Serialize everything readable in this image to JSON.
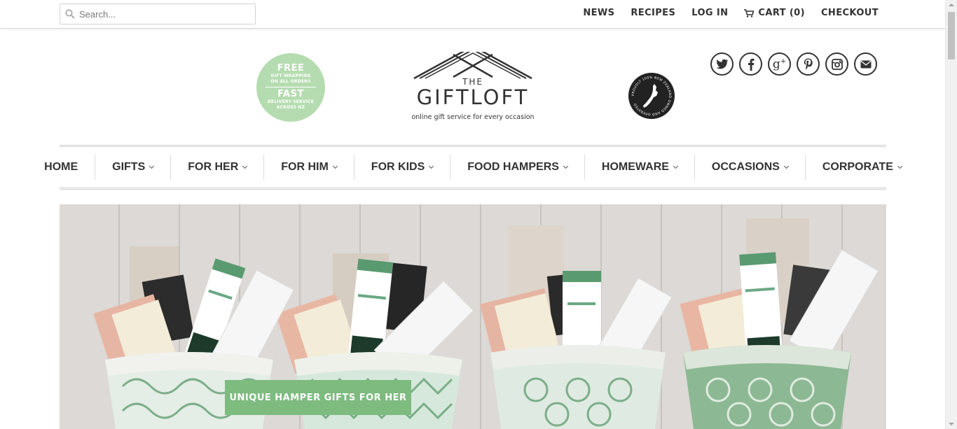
{
  "search": {
    "placeholder": "Search...",
    "icon": "search-icon"
  },
  "toplinks": [
    {
      "label": "NEWS"
    },
    {
      "label": "RECIPES"
    },
    {
      "label": "LOG IN"
    },
    {
      "label": "CART (0)",
      "icon": "cart-icon"
    },
    {
      "label": "CHECKOUT"
    }
  ],
  "badge": {
    "free": "FREE",
    "free_sub_1": "GIFT WRAPPING",
    "free_sub_2": "ON ALL ORDERS",
    "fast": "FAST",
    "fast_sub_1": "DELIVERY SERVICE",
    "fast_sub_2": "ACROSS NZ",
    "color": "#b5dcb0"
  },
  "logo": {
    "the": "THE",
    "name": "GIFTLOFT",
    "tagline": "online gift service for every occasion"
  },
  "nz_badge": {
    "text": "PROUDLY 100% NEW ZEALAND OWNED AND OPERATED"
  },
  "social": [
    {
      "icon": "twitter-icon"
    },
    {
      "icon": "facebook-icon"
    },
    {
      "icon": "google-plus-icon"
    },
    {
      "icon": "pinterest-icon"
    },
    {
      "icon": "instagram-icon"
    },
    {
      "icon": "email-icon"
    }
  ],
  "nav": [
    {
      "label": "HOME",
      "dropdown": false
    },
    {
      "label": "GIFTS",
      "dropdown": true
    },
    {
      "label": "FOR HER",
      "dropdown": true
    },
    {
      "label": "FOR HIM",
      "dropdown": true
    },
    {
      "label": "FOR KIDS",
      "dropdown": true
    },
    {
      "label": "FOOD HAMPERS",
      "dropdown": true
    },
    {
      "label": "HOMEWARE",
      "dropdown": true
    },
    {
      "label": "OCCASIONS",
      "dropdown": true
    },
    {
      "label": "CORPORATE",
      "dropdown": true
    }
  ],
  "hero": {
    "button_label": "UNIQUE HAMPER GIFTS FOR HER",
    "button_color": "#7dbb7f"
  }
}
